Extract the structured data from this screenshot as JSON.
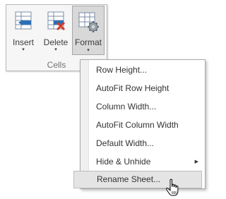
{
  "ribbon": {
    "buttons": [
      {
        "label": "Insert",
        "arrow": "▾"
      },
      {
        "label": "Delete",
        "arrow": "▾"
      },
      {
        "label": "Format",
        "arrow": "▾"
      }
    ],
    "group_label": "Cells"
  },
  "menu": {
    "items": [
      {
        "label": "Row Height..."
      },
      {
        "label": "AutoFit Row Height"
      },
      {
        "label": "Column Width..."
      },
      {
        "label": "AutoFit Column Width"
      },
      {
        "label": "Default Width..."
      },
      {
        "label": "Hide & Unhide",
        "submenu_arrow": "▶"
      },
      {
        "label": "Rename Sheet..."
      }
    ],
    "hovered_item": "Rename Sheet..."
  },
  "colors": {
    "accent_blue": "#2b6fb6",
    "delete_red": "#d23b2b",
    "pressed_bg": "#d8d8d8",
    "hover_bg": "#e4e4e4"
  },
  "icons": [
    "insert-cells-icon",
    "delete-cells-icon",
    "format-cells-icon",
    "hand-pointer-cursor-icon"
  ]
}
